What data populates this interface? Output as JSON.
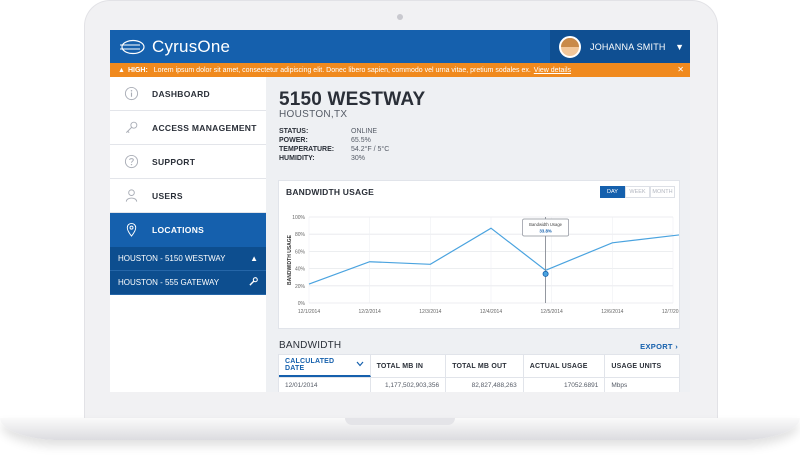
{
  "brand": {
    "name": "CyrusOne"
  },
  "user": {
    "name": "JOHANNA SMITH"
  },
  "alert": {
    "level": "HIGH:",
    "message": "Lorem ipsum dolor sit amet, consectetur adipiscing elit. Donec libero sapien, commodo vel urna vitae, pretium sodales ex.",
    "link": "View details"
  },
  "sidebar": {
    "items": [
      {
        "label": "DASHBOARD",
        "icon": "info-icon"
      },
      {
        "label": "ACCESS MANAGEMENT",
        "icon": "key-icon"
      },
      {
        "label": "SUPPORT",
        "icon": "help-icon"
      },
      {
        "label": "USERS",
        "icon": "user-icon"
      },
      {
        "label": "LOCATIONS",
        "icon": "location-pin-icon"
      }
    ],
    "locations": [
      {
        "label": "HOUSTON - 5150 WESTWAY",
        "icon": "warning-icon"
      },
      {
        "label": "HOUSTON - 555 GATEWAY",
        "icon": "wrench-icon"
      }
    ]
  },
  "site": {
    "title": "5150 WESTWAY",
    "city": "HOUSTON,TX",
    "stats": [
      {
        "key": "STATUS:",
        "value": "ONLINE"
      },
      {
        "key": "POWER:",
        "value": "65.5%"
      },
      {
        "key": "TEMPERATURE:",
        "value": "54.2°F / 5°C"
      },
      {
        "key": "HUMIDITY:",
        "value": "30%"
      }
    ]
  },
  "bandwidth_chart": {
    "title": "BANDWIDTH USAGE",
    "ranges": [
      "DAY",
      "WEEK",
      "MONTH"
    ],
    "selected_range": "DAY",
    "tooltip": {
      "label": "Bandwidth Usage",
      "value": "33.8%"
    }
  },
  "chart_data": {
    "type": "line",
    "title": "BANDWIDTH USAGE",
    "xlabel": "",
    "ylabel": "BANDWIDTH USAGE",
    "categories": [
      "12/1/2014",
      "12/2/2014",
      "12/3/2014",
      "12/4/2014",
      "12/5/2014",
      "12/6/2014",
      "12/7/2014"
    ],
    "yticks": [
      "100%",
      "80%",
      "60%",
      "40%",
      "20%",
      "0%"
    ],
    "ylim": [
      0,
      100
    ],
    "grid": true,
    "series": [
      {
        "x": [
          0,
          1,
          2,
          3,
          3.9,
          5,
          6.2
        ],
        "values": [
          22,
          48,
          45,
          87,
          38,
          70,
          80
        ]
      }
    ],
    "highlight": {
      "x": 3.9,
      "value": 33.8
    }
  },
  "bandwidth_table": {
    "title": "BANDWIDTH",
    "export_label": "EXPORT",
    "columns": [
      "CALCULATED DATE",
      "TOTAL MB IN",
      "TOTAL MB OUT",
      "ACTUAL USAGE",
      "USAGE UNITS"
    ],
    "rows": [
      [
        "12/01/2014",
        "1,177,502,903,356",
        "82,827,488,263",
        "17052.6891",
        "Mbps"
      ]
    ]
  },
  "colors": {
    "primary": "#1560ad",
    "alert": "#f08a1e",
    "line": "#4aa3df"
  }
}
